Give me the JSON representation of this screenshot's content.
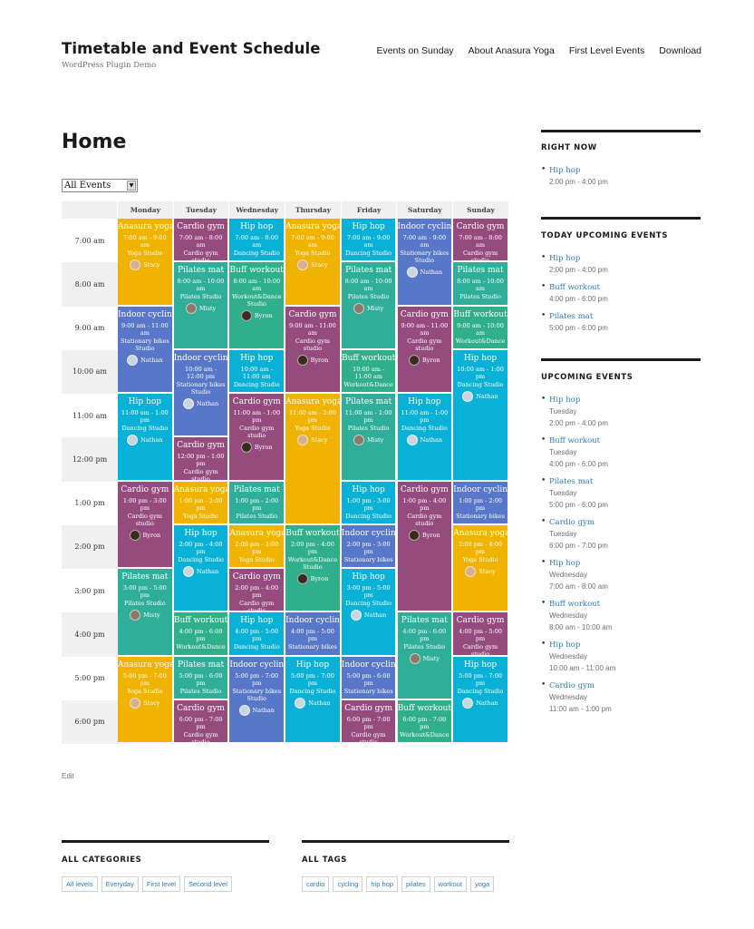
{
  "header": {
    "site_title": "Timetable and Event Schedule",
    "site_description": "WordPress Plugin Demo",
    "nav": [
      "Events on Sunday",
      "About Anasura Yoga",
      "First Level Events",
      "Download"
    ]
  },
  "page": {
    "title": "Home",
    "filter_select": "All Events",
    "edit_label": "Edit"
  },
  "colors": {
    "yoga": "#efb300",
    "cardio": "#964b7f",
    "hiphop": "#0ab1d6",
    "pilates": "#2fae99",
    "buff": "#2fb08a",
    "cycling": "#5877c9",
    "link": "#2b7bb9"
  },
  "timetable": {
    "days": [
      "Monday",
      "Tuesday",
      "Wednesday",
      "Thursday",
      "Friday",
      "Saturday",
      "Sunday"
    ],
    "hours": [
      "7:00 am",
      "8:00 am",
      "9:00 am",
      "10:00 am",
      "11:00 am",
      "12:00 pm",
      "1:00 pm",
      "2:00 pm",
      "3:00 pm",
      "4:00 pm",
      "5:00 pm",
      "6:00 pm"
    ],
    "events": [
      {
        "day": 0,
        "start": 0,
        "span": 2,
        "type": "yoga",
        "title": "Anasura yoga",
        "hours": "7:00 am - 9:00 am",
        "location": "Yoga Studio",
        "person": "Stacy"
      },
      {
        "day": 0,
        "start": 2,
        "span": 2,
        "type": "cycling",
        "title": "Indoor cycling",
        "hours": "9:00 am - 11:00 am",
        "location": "Stationary bikes Studio",
        "person": "Nathan"
      },
      {
        "day": 0,
        "start": 4,
        "span": 2,
        "type": "hiphop",
        "title": "Hip hop",
        "hours": "11:00 am - 1:00 pm",
        "location": "Dancing Studio",
        "person": "Nathan"
      },
      {
        "day": 0,
        "start": 6,
        "span": 2,
        "type": "cardio",
        "title": "Cardio gym",
        "hours": "1:00 pm - 3:00 pm",
        "location": "Cardio gym studio",
        "person": "Byron"
      },
      {
        "day": 0,
        "start": 8,
        "span": 2,
        "type": "pilates",
        "title": "Pilates mat",
        "hours": "3:00 pm - 5:00 pm",
        "location": "Pilates Studio",
        "person": "Misty"
      },
      {
        "day": 0,
        "start": 10,
        "span": 2,
        "type": "yoga",
        "title": "Anasura yoga",
        "hours": "5:00 pm - 7:00 pm",
        "location": "Yoga Studio",
        "person": "Stacy"
      },
      {
        "day": 1,
        "start": 0,
        "span": 1,
        "type": "cardio",
        "title": "Cardio gym",
        "hours": "7:00 am - 8:00 am",
        "location": "Cardio gym studio",
        "person": ""
      },
      {
        "day": 1,
        "start": 1,
        "span": 2,
        "type": "pilates",
        "title": "Pilates mat",
        "hours": "8:00 am - 10:00 am",
        "location": "Pilates Studio",
        "person": "Misty"
      },
      {
        "day": 1,
        "start": 3,
        "span": 2,
        "type": "cycling",
        "title": "Indoor cycling",
        "hours": "10:00 am - 12:00 pm",
        "location": "Stationary bikes Studio",
        "person": "Nathan"
      },
      {
        "day": 1,
        "start": 5,
        "span": 1,
        "type": "cardio",
        "title": "Cardio gym",
        "hours": "12:00 pm - 1:00 pm",
        "location": "Cardio gym studio",
        "person": ""
      },
      {
        "day": 1,
        "start": 6,
        "span": 1,
        "type": "yoga",
        "title": "Anasura yoga",
        "hours": "1:00 pm - 2:00 pm",
        "location": "Yoga Studio",
        "person": ""
      },
      {
        "day": 1,
        "start": 7,
        "span": 2,
        "type": "hiphop",
        "title": "Hip hop",
        "hours": "2:00 pm - 4:00 pm",
        "location": "Dancing Studio",
        "person": "Nathan"
      },
      {
        "day": 1,
        "start": 9,
        "span": 1,
        "type": "buff",
        "title": "Buff workout",
        "hours": "4:00 pm - 6:00 pm",
        "location": "Workout&Dance",
        "person": ""
      },
      {
        "day": 1,
        "start": 10,
        "span": 1,
        "type": "pilates",
        "title": "Pilates mat",
        "hours": "5:00 pm - 6:00 pm",
        "location": "Pilates Studio",
        "person": ""
      },
      {
        "day": 1,
        "start": 11,
        "span": 1,
        "type": "cardio",
        "title": "Cardio gym",
        "hours": "6:00 pm - 7:00 pm",
        "location": "Cardio gym studio",
        "person": ""
      },
      {
        "day": 2,
        "start": 0,
        "span": 1,
        "type": "hiphop",
        "title": "Hip hop",
        "hours": "7:00 am - 8:00 am",
        "location": "Dancing Studio",
        "person": ""
      },
      {
        "day": 2,
        "start": 1,
        "span": 2,
        "type": "buff",
        "title": "Buff workout",
        "hours": "8:00 am - 10:00 am",
        "location": "Workout&Dance Studio",
        "person": "Byron"
      },
      {
        "day": 2,
        "start": 3,
        "span": 1,
        "type": "hiphop",
        "title": "Hip hop",
        "hours": "10:00 am - 11:00 am",
        "location": "Dancing Studio",
        "person": ""
      },
      {
        "day": 2,
        "start": 4,
        "span": 2,
        "type": "cardio",
        "title": "Cardio gym",
        "hours": "11:00 am - 1:00 pm",
        "location": "Cardio gym studio",
        "person": "Byron"
      },
      {
        "day": 2,
        "start": 6,
        "span": 1,
        "type": "pilates",
        "title": "Pilates mat",
        "hours": "1:00 pm - 2:00 pm",
        "location": "Pilates Studio",
        "person": ""
      },
      {
        "day": 2,
        "start": 7,
        "span": 1,
        "type": "yoga",
        "title": "Anasura yoga",
        "hours": "2:00 pm - 3:00 pm",
        "location": "Yoga Studio",
        "person": ""
      },
      {
        "day": 2,
        "start": 8,
        "span": 1,
        "type": "cardio",
        "title": "Cardio gym",
        "hours": "2:00 pm - 4:00 pm",
        "location": "Cardio gym studio",
        "person": ""
      },
      {
        "day": 2,
        "start": 9,
        "span": 1,
        "type": "hiphop",
        "title": "Hip hop",
        "hours": "4:00 pm - 5:00 pm",
        "location": "Dancing Studio",
        "person": ""
      },
      {
        "day": 2,
        "start": 10,
        "span": 2,
        "type": "cycling",
        "title": "Indoor cycling",
        "hours": "5:00 pm - 7:00 pm",
        "location": "Stationary bikes Studio",
        "person": "Nathan"
      },
      {
        "day": 3,
        "start": 0,
        "span": 2,
        "type": "yoga",
        "title": "Anasura yoga",
        "hours": "7:00 am - 9:00 am",
        "location": "Yoga Studio",
        "person": "Stacy"
      },
      {
        "day": 3,
        "start": 2,
        "span": 2,
        "type": "cardio",
        "title": "Cardio gym",
        "hours": "9:00 am - 11:00 am",
        "location": "Cardio gym studio",
        "person": "Byron"
      },
      {
        "day": 3,
        "start": 4,
        "span": 3,
        "type": "yoga",
        "title": "Anasura yoga",
        "hours": "11:00 am - 2:00 pm",
        "location": "Yoga Studio",
        "person": "Stacy"
      },
      {
        "day": 3,
        "start": 7,
        "span": 2,
        "type": "buff",
        "title": "Buff workout",
        "hours": "2:00 pm - 4:00 pm",
        "location": "Workout&Dance Studio",
        "person": "Byron"
      },
      {
        "day": 3,
        "start": 9,
        "span": 1,
        "type": "cycling",
        "title": "Indoor cycling",
        "hours": "4:00 pm - 5:00 pm",
        "location": "Stationary bikes",
        "person": ""
      },
      {
        "day": 3,
        "start": 10,
        "span": 2,
        "type": "hiphop",
        "title": "Hip hop",
        "hours": "5:00 pm - 7:00 pm",
        "location": "Dancing Studio",
        "person": "Nathan"
      },
      {
        "day": 4,
        "start": 0,
        "span": 1,
        "type": "hiphop",
        "title": "Hip hop",
        "hours": "7:00 am - 9:00 am",
        "location": "Dancing Studio",
        "person": ""
      },
      {
        "day": 4,
        "start": 1,
        "span": 2,
        "type": "pilates",
        "title": "Pilates mat",
        "hours": "8:00 am - 10:00 am",
        "location": "Pilates Studio",
        "person": "Misty"
      },
      {
        "day": 4,
        "start": 3,
        "span": 1,
        "type": "buff",
        "title": "Buff workout",
        "hours": "10:00 am - 11:00 am",
        "location": "Workout&Dance",
        "person": ""
      },
      {
        "day": 4,
        "start": 4,
        "span": 2,
        "type": "pilates",
        "title": "Pilates mat",
        "hours": "11:00 am - 1:00 pm",
        "location": "Pilates Studio",
        "person": "Misty"
      },
      {
        "day": 4,
        "start": 6,
        "span": 1,
        "type": "hiphop",
        "title": "Hip hop",
        "hours": "1:00 pm - 3:00 pm",
        "location": "Dancing Studio",
        "person": ""
      },
      {
        "day": 4,
        "start": 7,
        "span": 1,
        "type": "cycling",
        "title": "Indoor cycling",
        "hours": "2:00 pm - 3:00 pm",
        "location": "Stationary bikes",
        "person": ""
      },
      {
        "day": 4,
        "start": 8,
        "span": 2,
        "type": "hiphop",
        "title": "Hip hop",
        "hours": "3:00 pm - 5:00 pm",
        "location": "Dancing Studio",
        "person": "Nathan"
      },
      {
        "day": 4,
        "start": 10,
        "span": 1,
        "type": "cycling",
        "title": "Indoor cycling",
        "hours": "5:00 pm - 6:00 pm",
        "location": "Stationary bikes",
        "person": ""
      },
      {
        "day": 4,
        "start": 11,
        "span": 1,
        "type": "cardio",
        "title": "Cardio gym",
        "hours": "6:00 pm - 7:00 pm",
        "location": "Cardio gym studio",
        "person": ""
      },
      {
        "day": 5,
        "start": 0,
        "span": 2,
        "type": "cycling",
        "title": "Indoor cycling",
        "hours": "7:00 am - 9:00 am",
        "location": "Stationary bikes Studio",
        "person": "Nathan"
      },
      {
        "day": 5,
        "start": 2,
        "span": 2,
        "type": "cardio",
        "title": "Cardio gym",
        "hours": "9:00 am - 11:00 am",
        "location": "Cardio gym studio",
        "person": "Byron"
      },
      {
        "day": 5,
        "start": 4,
        "span": 2,
        "type": "hiphop",
        "title": "Hip hop",
        "hours": "11:00 am - 1:00 pm",
        "location": "Dancing Studio",
        "person": "Nathan"
      },
      {
        "day": 5,
        "start": 6,
        "span": 3,
        "type": "cardio",
        "title": "Cardio gym",
        "hours": "1:00 pm - 4:00 pm",
        "location": "Cardio gym studio",
        "person": "Byron"
      },
      {
        "day": 5,
        "start": 9,
        "span": 2,
        "type": "pilates",
        "title": "Pilates mat",
        "hours": "4:00 pm - 6:00 pm",
        "location": "Pilates Studio",
        "person": "Misty"
      },
      {
        "day": 5,
        "start": 11,
        "span": 1,
        "type": "buff",
        "title": "Buff workout",
        "hours": "6:00 pm - 7:00 pm",
        "location": "Workout&Dance",
        "person": ""
      },
      {
        "day": 6,
        "start": 0,
        "span": 1,
        "type": "cardio",
        "title": "Cardio gym",
        "hours": "7:00 am - 8:00 am",
        "location": "Cardio gym studio",
        "person": ""
      },
      {
        "day": 6,
        "start": 1,
        "span": 1,
        "type": "pilates",
        "title": "Pilates mat",
        "hours": "8:00 am - 10:00 am",
        "location": "Pilates Studio",
        "person": ""
      },
      {
        "day": 6,
        "start": 2,
        "span": 1,
        "type": "buff",
        "title": "Buff workout",
        "hours": "9:00 am - 10:00 am",
        "location": "Workout&Dance",
        "person": ""
      },
      {
        "day": 6,
        "start": 3,
        "span": 3,
        "type": "hiphop",
        "title": "Hip hop",
        "hours": "10:00 am - 1:00 pm",
        "location": "Dancing Studio",
        "person": "Nathan"
      },
      {
        "day": 6,
        "start": 6,
        "span": 1,
        "type": "cycling",
        "title": "Indoor cycling",
        "hours": "1:00 pm - 2:00 pm",
        "location": "Stationary bikes",
        "person": ""
      },
      {
        "day": 6,
        "start": 7,
        "span": 2,
        "type": "yoga",
        "title": "Anasura yoga",
        "hours": "2:00 pm - 4:00 pm",
        "location": "Yoga Studio",
        "person": "Stacy"
      },
      {
        "day": 6,
        "start": 9,
        "span": 1,
        "type": "cardio",
        "title": "Cardio gym",
        "hours": "4:00 pm - 5:00 pm",
        "location": "Cardio gym studio",
        "person": ""
      },
      {
        "day": 6,
        "start": 10,
        "span": 2,
        "type": "hiphop",
        "title": "Hip hop",
        "hours": "5:00 pm - 7:00 pm",
        "location": "Dancing Studio",
        "person": "Nathan"
      }
    ]
  },
  "people_colors": {
    "Stacy": "#d9b08c",
    "Nathan": "#c9d6e0",
    "Byron": "#3b2a20",
    "Misty": "#8a7a6a"
  },
  "sidebar": {
    "right_now": {
      "title": "RIGHT NOW",
      "items": [
        {
          "name": "Hip hop",
          "time": "2:00 pm - 4:00 pm"
        }
      ]
    },
    "today_upcoming": {
      "title": "TODAY UPCOMING EVENTS",
      "items": [
        {
          "name": "Hip hop",
          "time": "2:00 pm - 4:00 pm"
        },
        {
          "name": "Buff workout",
          "time": "4:00 pm - 6:00 pm"
        },
        {
          "name": "Pilates mat",
          "time": "5:00 pm - 6:00 pm"
        }
      ]
    },
    "upcoming": {
      "title": "UPCOMING EVENTS",
      "items": [
        {
          "name": "Hip hop",
          "day": "Tuesday",
          "time": "2:00 pm - 4:00 pm"
        },
        {
          "name": "Buff workout",
          "day": "Tuesday",
          "time": "4:00 pm - 6:00 pm"
        },
        {
          "name": "Pilates mat",
          "day": "Tuesday",
          "time": "5:00 pm - 6:00 pm"
        },
        {
          "name": "Cardio gym",
          "day": "Tuesday",
          "time": "6:00 pm - 7:00 pm"
        },
        {
          "name": "Hip hop",
          "day": "Wednesday",
          "time": "7:00 am - 8:00 am"
        },
        {
          "name": "Buff workout",
          "day": "Wednesday",
          "time": "8:00 am - 10:00 am"
        },
        {
          "name": "Hip hop",
          "day": "Wednesday",
          "time": "10:00 am - 11:00 am"
        },
        {
          "name": "Cardio gym",
          "day": "Wednesday",
          "time": "11:00 am - 1:00 pm"
        }
      ]
    }
  },
  "footer": {
    "categories": {
      "title": "ALL CATEGORIES",
      "items": [
        "All levels",
        "Everyday",
        "First level",
        "Second level"
      ]
    },
    "tags": {
      "title": "ALL TAGS",
      "items": [
        "cardio",
        "cycling",
        "hip hop",
        "pilates",
        "workout",
        "yoga"
      ]
    }
  }
}
